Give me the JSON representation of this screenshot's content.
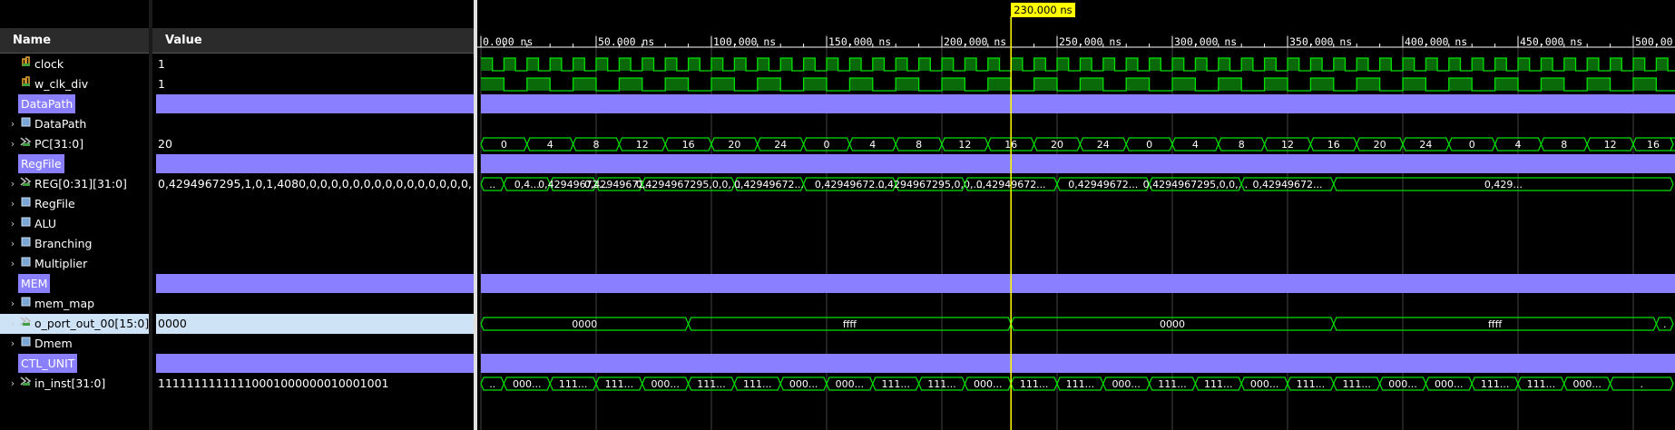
{
  "header": {
    "name_col": "Name",
    "value_col": "Value"
  },
  "cursor": {
    "label": "230.000 ns",
    "time_ns": 230
  },
  "time_axis": {
    "ticks": [
      "0.000 ns",
      "50.000 ns",
      "100.000 ns",
      "150.000 ns",
      "200.000 ns",
      "250.000 ns",
      "300.000 ns",
      "350.000 ns",
      "400.000 ns",
      "450.000 ns",
      "500.00"
    ]
  },
  "colors": {
    "wave": "#00e000",
    "group": "#8a7fff",
    "cursor": "#ffff00",
    "selected": "#cfe3f7"
  },
  "signals": [
    {
      "name": "clock",
      "value": "1",
      "kind": "clock",
      "icon": "bit-signal-icon",
      "expandable": false
    },
    {
      "name": "w_clk_div",
      "value": "1",
      "kind": "clkdiv",
      "icon": "bit-signal-icon",
      "expandable": false
    },
    {
      "name": "DataPath",
      "value": "",
      "kind": "group",
      "expandable": false
    },
    {
      "name": "DataPath",
      "value": "",
      "kind": "scope",
      "icon": "module-icon",
      "expandable": true
    },
    {
      "name": "PC[31:0]",
      "value": "20",
      "kind": "bus",
      "icon": "bus-signal-icon",
      "expandable": true,
      "bus_values": [
        "0",
        "4",
        "8",
        "12",
        "16",
        "20",
        "24",
        "0",
        "4",
        "8",
        "12",
        "16",
        "20",
        "24",
        "0",
        "4",
        "8",
        "12",
        "16",
        "20",
        "24",
        "0",
        "4",
        "8",
        "12",
        "16",
        "."
      ]
    },
    {
      "name": "RegFile",
      "value": "",
      "kind": "group",
      "expandable": false
    },
    {
      "name": "REG[0:31][31:0]",
      "value": "0,4294967295,1,0,1,4080,0,0,0,0,0,0,0,0,0,0,0,0,0,0,0,",
      "kind": "bus",
      "icon": "bus-signal-icon",
      "expandable": true,
      "bus_values": [
        "..",
        "0,4...",
        "0,42949672...",
        "0,42949672...",
        "0,4294967295,0,0,...",
        "0,42949672...",
        "0,42949672...",
        "0,4294967295,0,0,...",
        "0,42949672...",
        "0,42949672...",
        "0,4294967295,0,0,...",
        "0,42949672...",
        "0,429..."
      ]
    },
    {
      "name": "RegFile",
      "value": "",
      "kind": "scope",
      "icon": "module-icon",
      "expandable": true
    },
    {
      "name": "ALU",
      "value": "",
      "kind": "scope",
      "icon": "module-icon",
      "expandable": true
    },
    {
      "name": "Branching",
      "value": "",
      "kind": "scope",
      "icon": "module-icon",
      "expandable": true
    },
    {
      "name": "Multiplier",
      "value": "",
      "kind": "scope",
      "icon": "module-icon",
      "expandable": true
    },
    {
      "name": "MEM",
      "value": "",
      "kind": "group",
      "expandable": false
    },
    {
      "name": "mem_map",
      "value": "",
      "kind": "scope",
      "icon": "module-icon",
      "expandable": true
    },
    {
      "name": "o_port_out_00[15:0]",
      "value": "0000",
      "kind": "bus",
      "icon": "bus-signal-icon",
      "expandable": true,
      "selected": true,
      "bus_values": [
        "0000",
        "ffff",
        "0000",
        "ffff",
        "."
      ]
    },
    {
      "name": "Dmem",
      "value": "",
      "kind": "scope",
      "icon": "module-icon",
      "expandable": true
    },
    {
      "name": "CTL_UNIT",
      "value": "",
      "kind": "group",
      "expandable": false
    },
    {
      "name": "in_inst[31:0]",
      "value": "11111111111110001000000010001001",
      "kind": "bus",
      "icon": "bus-signal-icon",
      "expandable": true,
      "bus_values": [
        "..",
        "000...",
        "111...",
        "111...",
        "000...",
        "111...",
        "111...",
        "000...",
        "000...",
        "111...",
        "111...",
        "000...",
        "111...",
        "111...",
        "000...",
        "111...",
        "111...",
        "000...",
        "111...",
        "111...",
        "000...",
        "000...",
        "111...",
        "111...",
        "000...",
        "."
      ]
    }
  ]
}
